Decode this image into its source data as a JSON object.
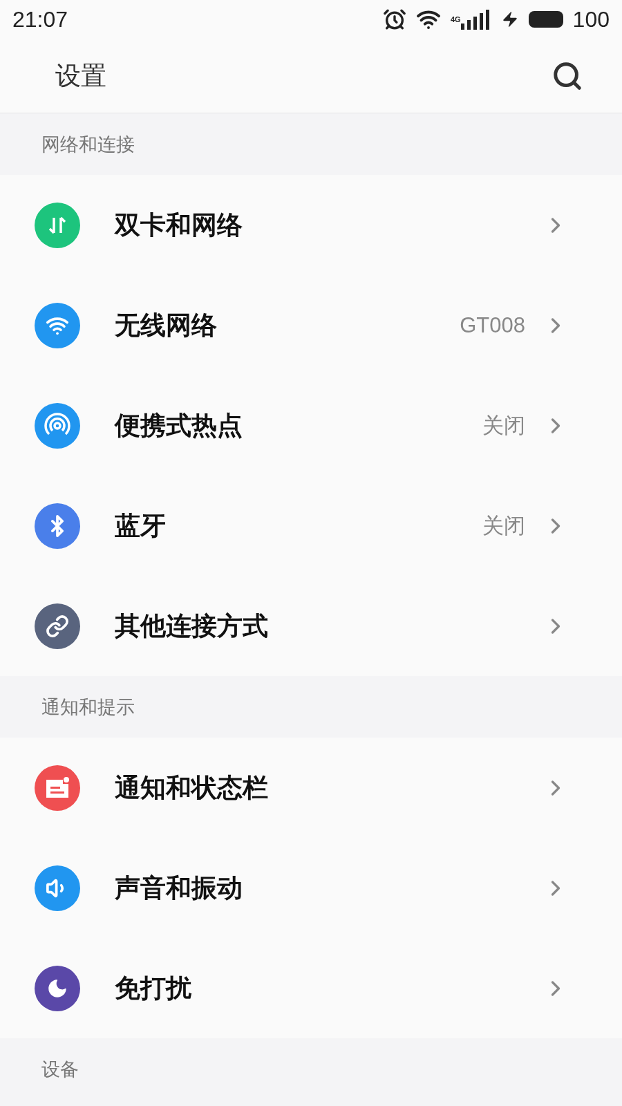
{
  "status_bar": {
    "time": "21:07",
    "network": "4G",
    "battery": "100"
  },
  "header": {
    "title": "设置"
  },
  "sections": [
    {
      "title": "网络和连接",
      "items": [
        {
          "kind": "sim",
          "label": "双卡和网络"
        },
        {
          "kind": "wifi",
          "label": "无线网络",
          "value": "GT008"
        },
        {
          "kind": "hotspot",
          "label": "便携式热点",
          "value": "关闭"
        },
        {
          "kind": "bluetooth",
          "label": "蓝牙",
          "value": "关闭"
        },
        {
          "kind": "link",
          "label": "其他连接方式"
        }
      ]
    },
    {
      "title": "通知和提示",
      "items": [
        {
          "kind": "notification",
          "label": "通知和状态栏"
        },
        {
          "kind": "sound",
          "label": "声音和振动"
        },
        {
          "kind": "dnd",
          "label": "免打扰"
        }
      ]
    },
    {
      "title": "设备"
    }
  ]
}
